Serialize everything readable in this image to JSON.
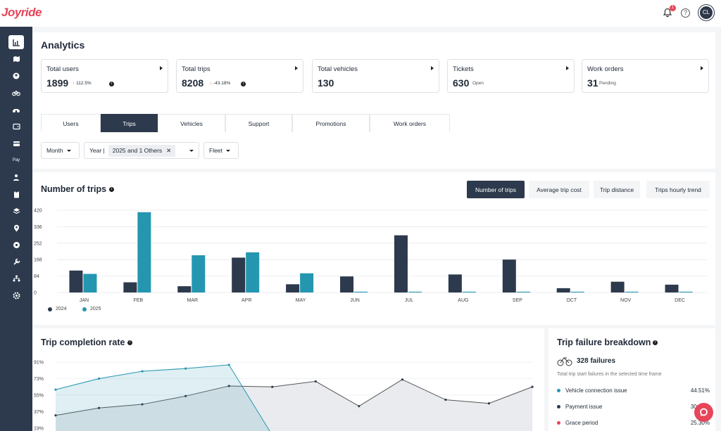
{
  "app": {
    "logo": "Joyride"
  },
  "topbar": {
    "notif_count": "1",
    "avatar_initials": "CL"
  },
  "sidebar": {
    "items": [
      "analytics",
      "map",
      "users",
      "bikes",
      "scooters",
      "wallet",
      "cards",
      "pay",
      "staff",
      "tasks",
      "layers",
      "location",
      "settings-gear",
      "tools",
      "hierarchy",
      "config"
    ],
    "pay_label": "Pay"
  },
  "page": {
    "title": "Analytics"
  },
  "stats": [
    {
      "label": "Total users",
      "value": "1899",
      "sub": "112.5%",
      "trend": "up"
    },
    {
      "label": "Total trips",
      "value": "8208",
      "sub": "-43.18%",
      "trend": "down"
    },
    {
      "label": "Total vehicles",
      "value": "130",
      "sub": ""
    },
    {
      "label": "Tickets",
      "value": "630",
      "sub": "Open"
    },
    {
      "label": "Work orders",
      "value": "31",
      "sub": "Pending"
    }
  ],
  "tabs": [
    {
      "label": "Users",
      "active": false
    },
    {
      "label": "Trips",
      "active": true
    },
    {
      "label": "Vehicles",
      "active": false
    },
    {
      "label": "Support",
      "active": false
    },
    {
      "label": "Promotions",
      "active": false
    },
    {
      "label": "Work orders",
      "active": false
    }
  ],
  "filters": {
    "period": "Month",
    "year_label": "Year |",
    "year_value": "2025 and 1 Others",
    "fleet": "Fleet"
  },
  "trips_chart": {
    "title": "Number of trips",
    "tabs": [
      "Number of trips",
      "Average trip cost",
      "Trip distance",
      "Trips hourly trend"
    ]
  },
  "completion": {
    "title": "Trip completion rate",
    "ticks": [
      "91%",
      "73%",
      "55%",
      "37%",
      "19%"
    ]
  },
  "failure": {
    "title": "Trip failure breakdown",
    "count": "328 failures",
    "subtitle": "Total trip start failures in the selected time frame",
    "rows": [
      {
        "label": "Vehicle connection issue",
        "pct": "44.51%",
        "color": "#2596b0"
      },
      {
        "label": "Payment issue",
        "pct": "30.18%",
        "color": "#2d3a4d"
      },
      {
        "label": "Grace period",
        "pct": "25.30%",
        "color": "#e8455a"
      }
    ]
  },
  "colors": {
    "sidebar": "#2d3a4d",
    "series2024": "#2d3a4d",
    "series2025": "#2596b0",
    "accent": "#e8455a"
  },
  "chart_data": [
    {
      "type": "bar",
      "title": "Number of trips",
      "categories": [
        "JAN",
        "FEB",
        "MAR",
        "APR",
        "MAY",
        "JUN",
        "JUL",
        "AUG",
        "SEP",
        "OCT",
        "NOV",
        "DEC"
      ],
      "yticks": [
        420,
        336,
        252,
        168,
        84,
        0
      ],
      "ylim": [
        0,
        420
      ],
      "legend": "bottom-left",
      "series": [
        {
          "name": "2024",
          "values": [
            112,
            52,
            32,
            178,
            42,
            82,
            292,
            92,
            168,
            22,
            55,
            40
          ]
        },
        {
          "name": "2025",
          "values": [
            95,
            410,
            190,
            205,
            98,
            4,
            4,
            4,
            4,
            4,
            4,
            4
          ]
        }
      ]
    },
    {
      "type": "area",
      "title": "Trip completion rate",
      "yticks": [
        "91%",
        "73%",
        "55%",
        "37%",
        "19%"
      ],
      "ylim": [
        19,
        91
      ],
      "series": [
        {
          "values": [
            33,
            41,
            45,
            54,
            65,
            64,
            70,
            43,
            72,
            50,
            46,
            64
          ]
        },
        {
          "values": [
            61,
            73,
            81,
            84,
            88,
            0
          ]
        }
      ]
    }
  ]
}
